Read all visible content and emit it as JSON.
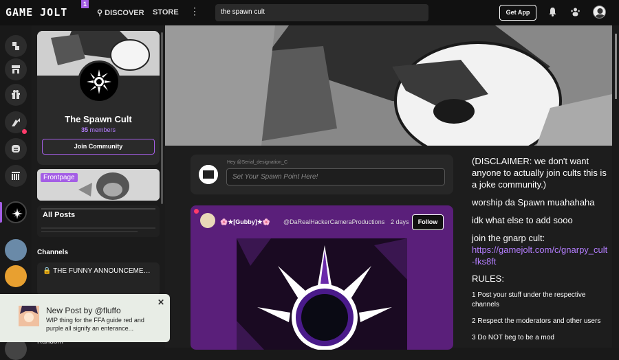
{
  "header": {
    "logo_text": "GAME JOLT",
    "logo_badge": "1",
    "discover": "DISCOVER",
    "store": "STORE",
    "more": "⋮",
    "search_value": "the spawn cult",
    "get_app": "Get App"
  },
  "community": {
    "name": "The Spawn Cult",
    "member_count": "35",
    "members_label": "members",
    "join": "Join Community"
  },
  "channels": {
    "frontpage": "Frontpage",
    "all_posts": "All Posts",
    "title": "Channels",
    "funny": "THE FUNNY ANNOUNCEMEN…",
    "random": "Random"
  },
  "compose": {
    "greeting": "Hey @Serial_designation_C",
    "placeholder": "Set Your Spawn Point Here!"
  },
  "post": {
    "author": "🌸★[Gubby]★🌸",
    "handle": "@DaRealHackerCameraProductions",
    "time": "2 days",
    "follow": "Follow"
  },
  "about": {
    "disclaimer": "(DISCLAIMER: we don't want anyone to actually join cults this is a joke community.)",
    "worship": "worship da Spawn muahahaha",
    "idk": "idk what else to add sooo",
    "join_gnarp": "join the gnarp cult:",
    "gnarp_link": "https://gamejolt.com/c/gnarpy_cult-fks8ft",
    "rules": "RULES:",
    "rule1": "1 Post your stuff under the respective channels",
    "rule2": "2 Respect the moderators and other users",
    "rule3": "3 Do NOT beg to be a mod"
  },
  "toast": {
    "title": "New Post by @fluffo",
    "body": "WIP thing for the FFA guide red and purple all signify an enterance...",
    "close": "✕"
  },
  "colors": {
    "accent": "#a45ee5",
    "notification": "#ff3b6a"
  }
}
